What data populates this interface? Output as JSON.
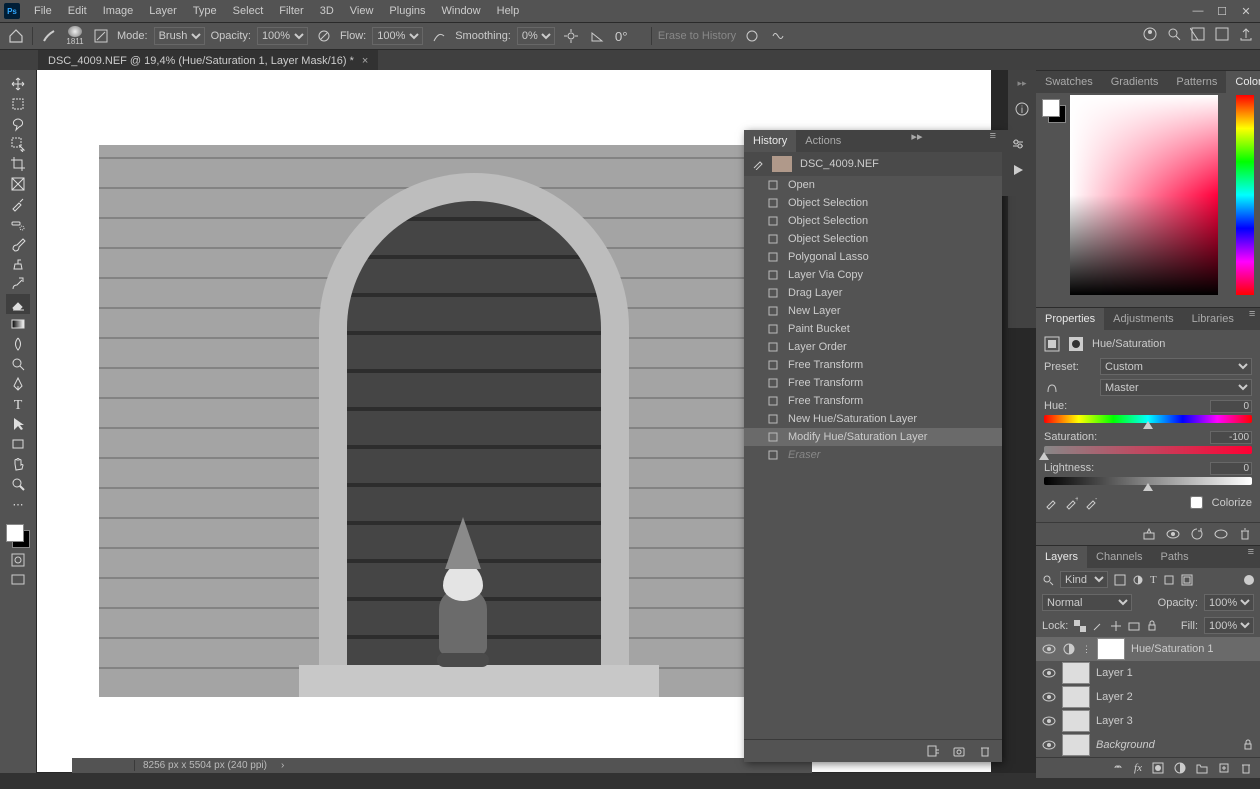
{
  "menubar": {
    "items": [
      "File",
      "Edit",
      "Image",
      "Layer",
      "Type",
      "Select",
      "Filter",
      "3D",
      "View",
      "Plugins",
      "Window",
      "Help"
    ]
  },
  "options_bar": {
    "brush_size": "1811",
    "mode_label": "Mode:",
    "mode_value": "Brush",
    "opacity_label": "Opacity:",
    "opacity_value": "100%",
    "flow_label": "Flow:",
    "flow_value": "100%",
    "smoothing_label": "Smoothing:",
    "smoothing_value": "0%",
    "angle_label": "",
    "angle_value": "0°",
    "erase_history": "Erase to History"
  },
  "document_tab": {
    "title": "DSC_4009.NEF @ 19,4% (Hue/Saturation 1, Layer Mask/16) *",
    "close": "×"
  },
  "statusbar": {
    "zoom": "",
    "dimensions": "8256 px x 5504 px (240 ppi)",
    "chev": "›"
  },
  "tools": [
    "move-tool",
    "marquee-tool",
    "lasso-tool",
    "object-select-tool",
    "crop-tool",
    "frame-tool",
    "eyedropper-tool",
    "spot-heal-tool",
    "brush-tool",
    "clone-stamp-tool",
    "history-brush-tool",
    "eraser-tool",
    "gradient-tool",
    "blur-tool",
    "dodge-tool",
    "pen-tool",
    "type-tool",
    "path-select-tool",
    "rectangle-tool",
    "hand-tool",
    "zoom-tool"
  ],
  "active_tool_index": 11,
  "dock_icons": [
    "info-icon",
    "histogram-icon",
    "navigator-icon"
  ],
  "history_side_icons": [
    "adjustment-icon",
    "play-icon"
  ],
  "color_panel": {
    "tabs": [
      "Swatches",
      "Gradients",
      "Patterns",
      "Color"
    ],
    "active": 3
  },
  "properties_panel": {
    "tabs": [
      "Properties",
      "Adjustments",
      "Libraries"
    ],
    "active": 0,
    "title": "Hue/Saturation",
    "preset_label": "Preset:",
    "preset_value": "Custom",
    "channel_value": "Master",
    "hue_label": "Hue:",
    "hue_value": "0",
    "sat_label": "Saturation:",
    "sat_value": "-100",
    "light_label": "Lightness:",
    "light_value": "0",
    "colorize_label": "Colorize"
  },
  "layers_panel": {
    "tabs": [
      "Layers",
      "Channels",
      "Paths"
    ],
    "active": 0,
    "kind_label": "Kind",
    "blend_mode": "Normal",
    "opacity_label": "Opacity:",
    "opacity_value": "100%",
    "lock_label": "Lock:",
    "fill_label": "Fill:",
    "fill_value": "100%",
    "layers": [
      {
        "name": "Hue/Saturation 1",
        "adjustment": true,
        "mask": true,
        "active": true
      },
      {
        "name": "Layer 1"
      },
      {
        "name": "Layer 2"
      },
      {
        "name": "Layer 3"
      },
      {
        "name": "Background",
        "locked": true,
        "italic": true
      }
    ]
  },
  "history_panel": {
    "tabs": [
      "History",
      "Actions"
    ],
    "active": 0,
    "doc": "DSC_4009.NEF",
    "items": [
      {
        "label": "Open"
      },
      {
        "label": "Object Selection"
      },
      {
        "label": "Object Selection"
      },
      {
        "label": "Object Selection"
      },
      {
        "label": "Polygonal Lasso"
      },
      {
        "label": "Layer Via Copy"
      },
      {
        "label": "Drag Layer"
      },
      {
        "label": "New Layer"
      },
      {
        "label": "Paint Bucket"
      },
      {
        "label": "Layer Order"
      },
      {
        "label": "Free Transform"
      },
      {
        "label": "Free Transform"
      },
      {
        "label": "Free Transform"
      },
      {
        "label": "New Hue/Saturation Layer"
      },
      {
        "label": "Modify Hue/Saturation Layer",
        "selected": true
      },
      {
        "label": "Eraser",
        "dim": true
      }
    ]
  }
}
